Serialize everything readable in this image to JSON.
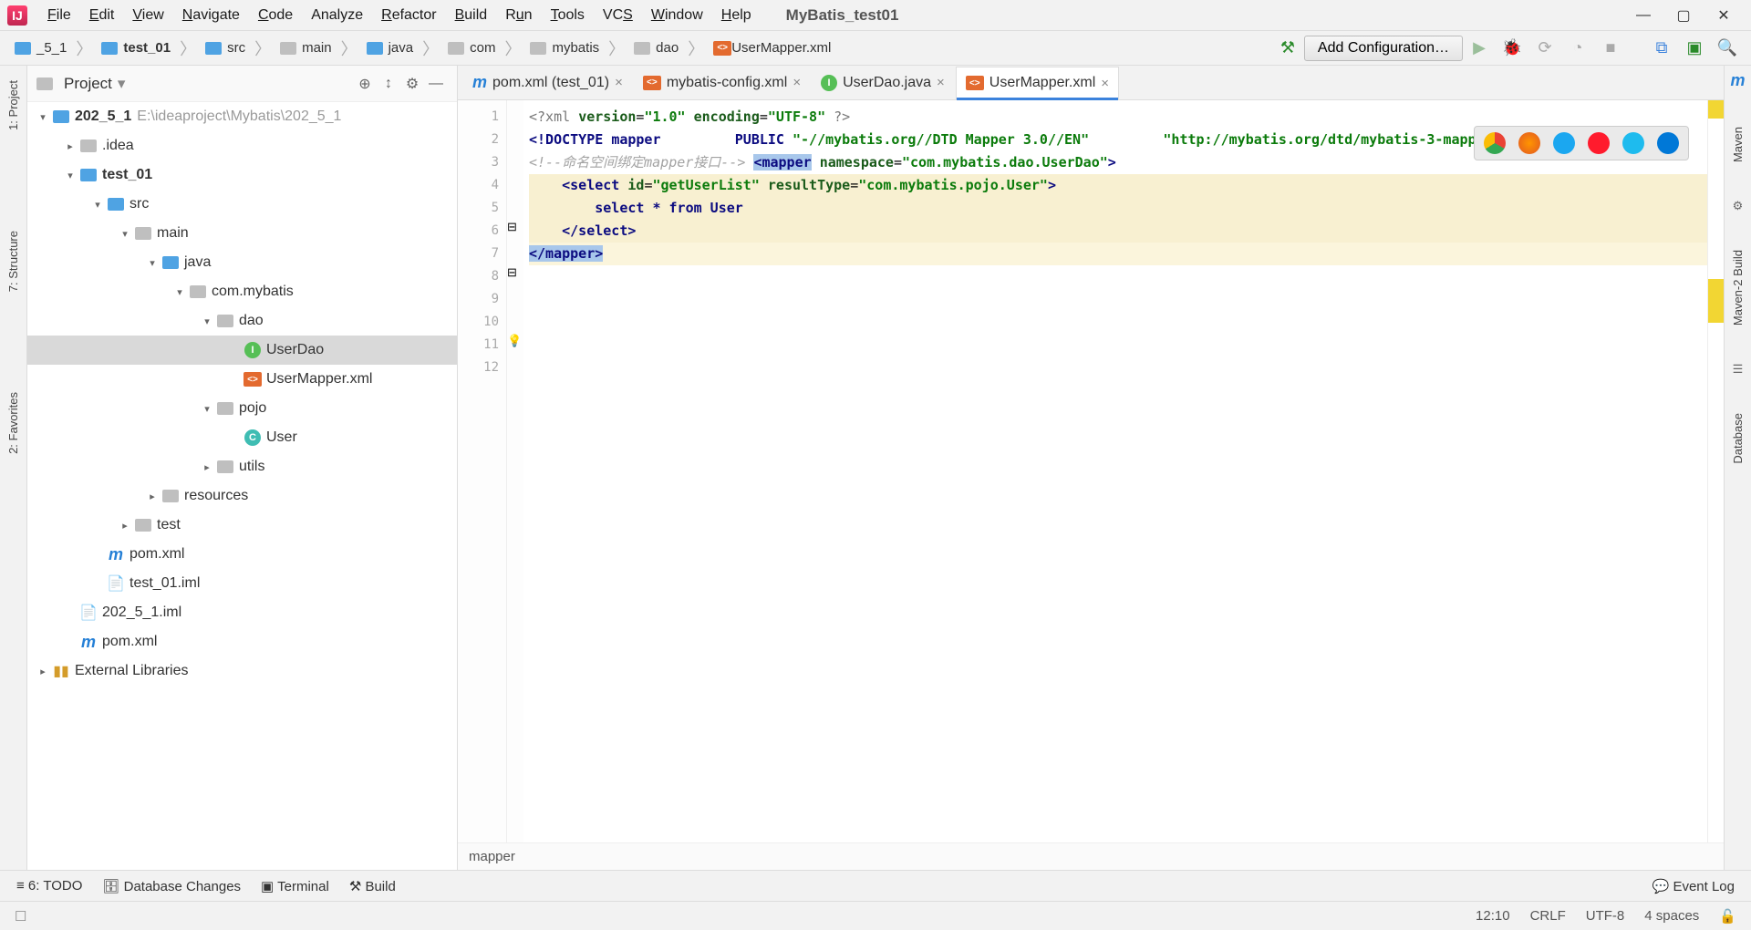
{
  "windowTitle": "MyBatis_test01",
  "menu": [
    "File",
    "Edit",
    "View",
    "Navigate",
    "Code",
    "Analyze",
    "Refactor",
    "Build",
    "Run",
    "Tools",
    "VCS",
    "Window",
    "Help"
  ],
  "breadcrumbs": [
    {
      "label": "_5_1",
      "kind": "blue"
    },
    {
      "label": "test_01",
      "kind": "blue"
    },
    {
      "label": "src",
      "kind": "blue"
    },
    {
      "label": "main",
      "kind": "gray"
    },
    {
      "label": "java",
      "kind": "blue"
    },
    {
      "label": "com",
      "kind": "gray"
    },
    {
      "label": "mybatis",
      "kind": "gray"
    },
    {
      "label": "dao",
      "kind": "gray"
    },
    {
      "label": "UserMapper.xml",
      "kind": "xml"
    }
  ],
  "addConfig": "Add Configuration…",
  "leftRail": [
    "1: Project",
    "7: Structure",
    "2: Favorites"
  ],
  "rightRail": [
    "Maven",
    "Maven-2 Build",
    "Database"
  ],
  "projectPanel": {
    "title": "Project",
    "tree": [
      {
        "depth": 0,
        "arrow": "▾",
        "icon": "square-blue",
        "label": "202_5_1",
        "note": "E:\\ideaproject\\Mybatis\\202_5_1",
        "bold": true
      },
      {
        "depth": 1,
        "arrow": "▸",
        "icon": "square-gray",
        "label": ".idea"
      },
      {
        "depth": 1,
        "arrow": "▾",
        "icon": "square-blue",
        "label": "test_01",
        "bold": true
      },
      {
        "depth": 2,
        "arrow": "▾",
        "icon": "square-blue",
        "label": "src"
      },
      {
        "depth": 3,
        "arrow": "▾",
        "icon": "square-gray",
        "label": "main"
      },
      {
        "depth": 4,
        "arrow": "▾",
        "icon": "square-blue",
        "label": "java"
      },
      {
        "depth": 5,
        "arrow": "▾",
        "icon": "square-gray",
        "label": "com.mybatis"
      },
      {
        "depth": 6,
        "arrow": "▾",
        "icon": "square-gray",
        "label": "dao"
      },
      {
        "depth": 7,
        "arrow": "",
        "icon": "circle-green",
        "iconText": "I",
        "label": "UserDao",
        "selected": true
      },
      {
        "depth": 7,
        "arrow": "",
        "icon": "xml",
        "label": "UserMapper.xml"
      },
      {
        "depth": 6,
        "arrow": "▾",
        "icon": "square-gray",
        "label": "pojo"
      },
      {
        "depth": 7,
        "arrow": "",
        "icon": "circle-teal",
        "iconText": "C",
        "label": "User"
      },
      {
        "depth": 6,
        "arrow": "▸",
        "icon": "square-gray",
        "label": "utils"
      },
      {
        "depth": 4,
        "arrow": "▸",
        "icon": "square-gray",
        "label": "resources"
      },
      {
        "depth": 3,
        "arrow": "▸",
        "icon": "square-gray",
        "label": "test"
      },
      {
        "depth": 2,
        "arrow": "",
        "icon": "letter-m",
        "label": "pom.xml"
      },
      {
        "depth": 2,
        "arrow": "",
        "icon": "file",
        "label": "test_01.iml"
      },
      {
        "depth": 1,
        "arrow": "",
        "icon": "file",
        "label": "202_5_1.iml"
      },
      {
        "depth": 1,
        "arrow": "",
        "icon": "letter-m",
        "label": "pom.xml"
      },
      {
        "depth": 0,
        "arrow": "▸",
        "icon": "lib",
        "label": "External Libraries"
      }
    ]
  },
  "editorTabs": [
    {
      "label": "pom.xml (test_01)",
      "icon": "letter-m"
    },
    {
      "label": "mybatis-config.xml",
      "icon": "xml"
    },
    {
      "label": "UserDao.java",
      "icon": "circle-green",
      "iconText": "I"
    },
    {
      "label": "UserMapper.xml",
      "icon": "xml",
      "active": true
    }
  ],
  "code": {
    "lines": [
      "1",
      "2",
      "3",
      "4",
      "5",
      "6",
      "7",
      "8",
      "9",
      "10",
      "11",
      "12"
    ],
    "content": {
      "l1": {
        "pre": "<?xml ",
        "a1": "version",
        "v1": "\"1.0\"",
        "a2": " encoding",
        "v2": "\"UTF-8\"",
        "post": " ?>"
      },
      "l2": {
        "t": "<!DOCTYPE ",
        "k": "mapper"
      },
      "l3": {
        "k": "PUBLIC ",
        "s": "\"-//mybatis.org//DTD Mapper 3.0//EN\""
      },
      "l4": {
        "s": "\"http://mybatis.org/dtd/mybatis-3-mapper.dtd\"",
        "end": ">"
      },
      "l5": "<!--命名空间绑定mapper接口-->",
      "l6": {
        "t": "<mapper",
        "sp": " ",
        "a": "namespace",
        "eq": "=",
        "v": "\"com.mybatis.dao.UserDao\"",
        "end": ">"
      },
      "l8": {
        "t": "<select ",
        "a1": "id",
        "v1": "\"getUserList\"",
        "a2": " resultType",
        "v2": "\"com.mybatis.pojo.User\"",
        "end": ">"
      },
      "l9": "select * from User",
      "l10": "</select>",
      "l12": "</mapper>"
    }
  },
  "bottomCrumb": "mapper",
  "bottomTools": [
    "6: TODO",
    "Database Changes",
    "Terminal",
    "Build"
  ],
  "eventLog": "Event Log",
  "statusRight": [
    "12:10",
    "CRLF",
    "UTF-8",
    "4 spaces"
  ]
}
